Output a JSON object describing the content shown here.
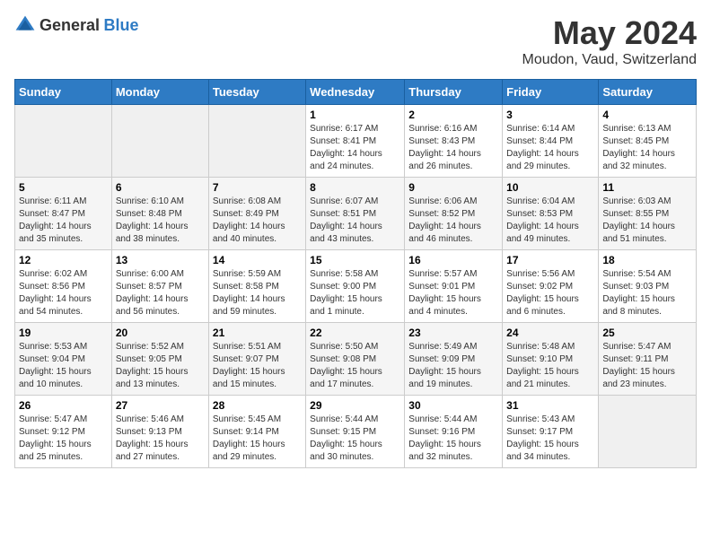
{
  "logo": {
    "text_general": "General",
    "text_blue": "Blue"
  },
  "header": {
    "month": "May 2024",
    "location": "Moudon, Vaud, Switzerland"
  },
  "weekdays": [
    "Sunday",
    "Monday",
    "Tuesday",
    "Wednesday",
    "Thursday",
    "Friday",
    "Saturday"
  ],
  "weeks": [
    [
      {
        "day": "",
        "info": ""
      },
      {
        "day": "",
        "info": ""
      },
      {
        "day": "",
        "info": ""
      },
      {
        "day": "1",
        "info": "Sunrise: 6:17 AM\nSunset: 8:41 PM\nDaylight: 14 hours\nand 24 minutes."
      },
      {
        "day": "2",
        "info": "Sunrise: 6:16 AM\nSunset: 8:43 PM\nDaylight: 14 hours\nand 26 minutes."
      },
      {
        "day": "3",
        "info": "Sunrise: 6:14 AM\nSunset: 8:44 PM\nDaylight: 14 hours\nand 29 minutes."
      },
      {
        "day": "4",
        "info": "Sunrise: 6:13 AM\nSunset: 8:45 PM\nDaylight: 14 hours\nand 32 minutes."
      }
    ],
    [
      {
        "day": "5",
        "info": "Sunrise: 6:11 AM\nSunset: 8:47 PM\nDaylight: 14 hours\nand 35 minutes."
      },
      {
        "day": "6",
        "info": "Sunrise: 6:10 AM\nSunset: 8:48 PM\nDaylight: 14 hours\nand 38 minutes."
      },
      {
        "day": "7",
        "info": "Sunrise: 6:08 AM\nSunset: 8:49 PM\nDaylight: 14 hours\nand 40 minutes."
      },
      {
        "day": "8",
        "info": "Sunrise: 6:07 AM\nSunset: 8:51 PM\nDaylight: 14 hours\nand 43 minutes."
      },
      {
        "day": "9",
        "info": "Sunrise: 6:06 AM\nSunset: 8:52 PM\nDaylight: 14 hours\nand 46 minutes."
      },
      {
        "day": "10",
        "info": "Sunrise: 6:04 AM\nSunset: 8:53 PM\nDaylight: 14 hours\nand 49 minutes."
      },
      {
        "day": "11",
        "info": "Sunrise: 6:03 AM\nSunset: 8:55 PM\nDaylight: 14 hours\nand 51 minutes."
      }
    ],
    [
      {
        "day": "12",
        "info": "Sunrise: 6:02 AM\nSunset: 8:56 PM\nDaylight: 14 hours\nand 54 minutes."
      },
      {
        "day": "13",
        "info": "Sunrise: 6:00 AM\nSunset: 8:57 PM\nDaylight: 14 hours\nand 56 minutes."
      },
      {
        "day": "14",
        "info": "Sunrise: 5:59 AM\nSunset: 8:58 PM\nDaylight: 14 hours\nand 59 minutes."
      },
      {
        "day": "15",
        "info": "Sunrise: 5:58 AM\nSunset: 9:00 PM\nDaylight: 15 hours\nand 1 minute."
      },
      {
        "day": "16",
        "info": "Sunrise: 5:57 AM\nSunset: 9:01 PM\nDaylight: 15 hours\nand 4 minutes."
      },
      {
        "day": "17",
        "info": "Sunrise: 5:56 AM\nSunset: 9:02 PM\nDaylight: 15 hours\nand 6 minutes."
      },
      {
        "day": "18",
        "info": "Sunrise: 5:54 AM\nSunset: 9:03 PM\nDaylight: 15 hours\nand 8 minutes."
      }
    ],
    [
      {
        "day": "19",
        "info": "Sunrise: 5:53 AM\nSunset: 9:04 PM\nDaylight: 15 hours\nand 10 minutes."
      },
      {
        "day": "20",
        "info": "Sunrise: 5:52 AM\nSunset: 9:05 PM\nDaylight: 15 hours\nand 13 minutes."
      },
      {
        "day": "21",
        "info": "Sunrise: 5:51 AM\nSunset: 9:07 PM\nDaylight: 15 hours\nand 15 minutes."
      },
      {
        "day": "22",
        "info": "Sunrise: 5:50 AM\nSunset: 9:08 PM\nDaylight: 15 hours\nand 17 minutes."
      },
      {
        "day": "23",
        "info": "Sunrise: 5:49 AM\nSunset: 9:09 PM\nDaylight: 15 hours\nand 19 minutes."
      },
      {
        "day": "24",
        "info": "Sunrise: 5:48 AM\nSunset: 9:10 PM\nDaylight: 15 hours\nand 21 minutes."
      },
      {
        "day": "25",
        "info": "Sunrise: 5:47 AM\nSunset: 9:11 PM\nDaylight: 15 hours\nand 23 minutes."
      }
    ],
    [
      {
        "day": "26",
        "info": "Sunrise: 5:47 AM\nSunset: 9:12 PM\nDaylight: 15 hours\nand 25 minutes."
      },
      {
        "day": "27",
        "info": "Sunrise: 5:46 AM\nSunset: 9:13 PM\nDaylight: 15 hours\nand 27 minutes."
      },
      {
        "day": "28",
        "info": "Sunrise: 5:45 AM\nSunset: 9:14 PM\nDaylight: 15 hours\nand 29 minutes."
      },
      {
        "day": "29",
        "info": "Sunrise: 5:44 AM\nSunset: 9:15 PM\nDaylight: 15 hours\nand 30 minutes."
      },
      {
        "day": "30",
        "info": "Sunrise: 5:44 AM\nSunset: 9:16 PM\nDaylight: 15 hours\nand 32 minutes."
      },
      {
        "day": "31",
        "info": "Sunrise: 5:43 AM\nSunset: 9:17 PM\nDaylight: 15 hours\nand 34 minutes."
      },
      {
        "day": "",
        "info": ""
      }
    ]
  ]
}
